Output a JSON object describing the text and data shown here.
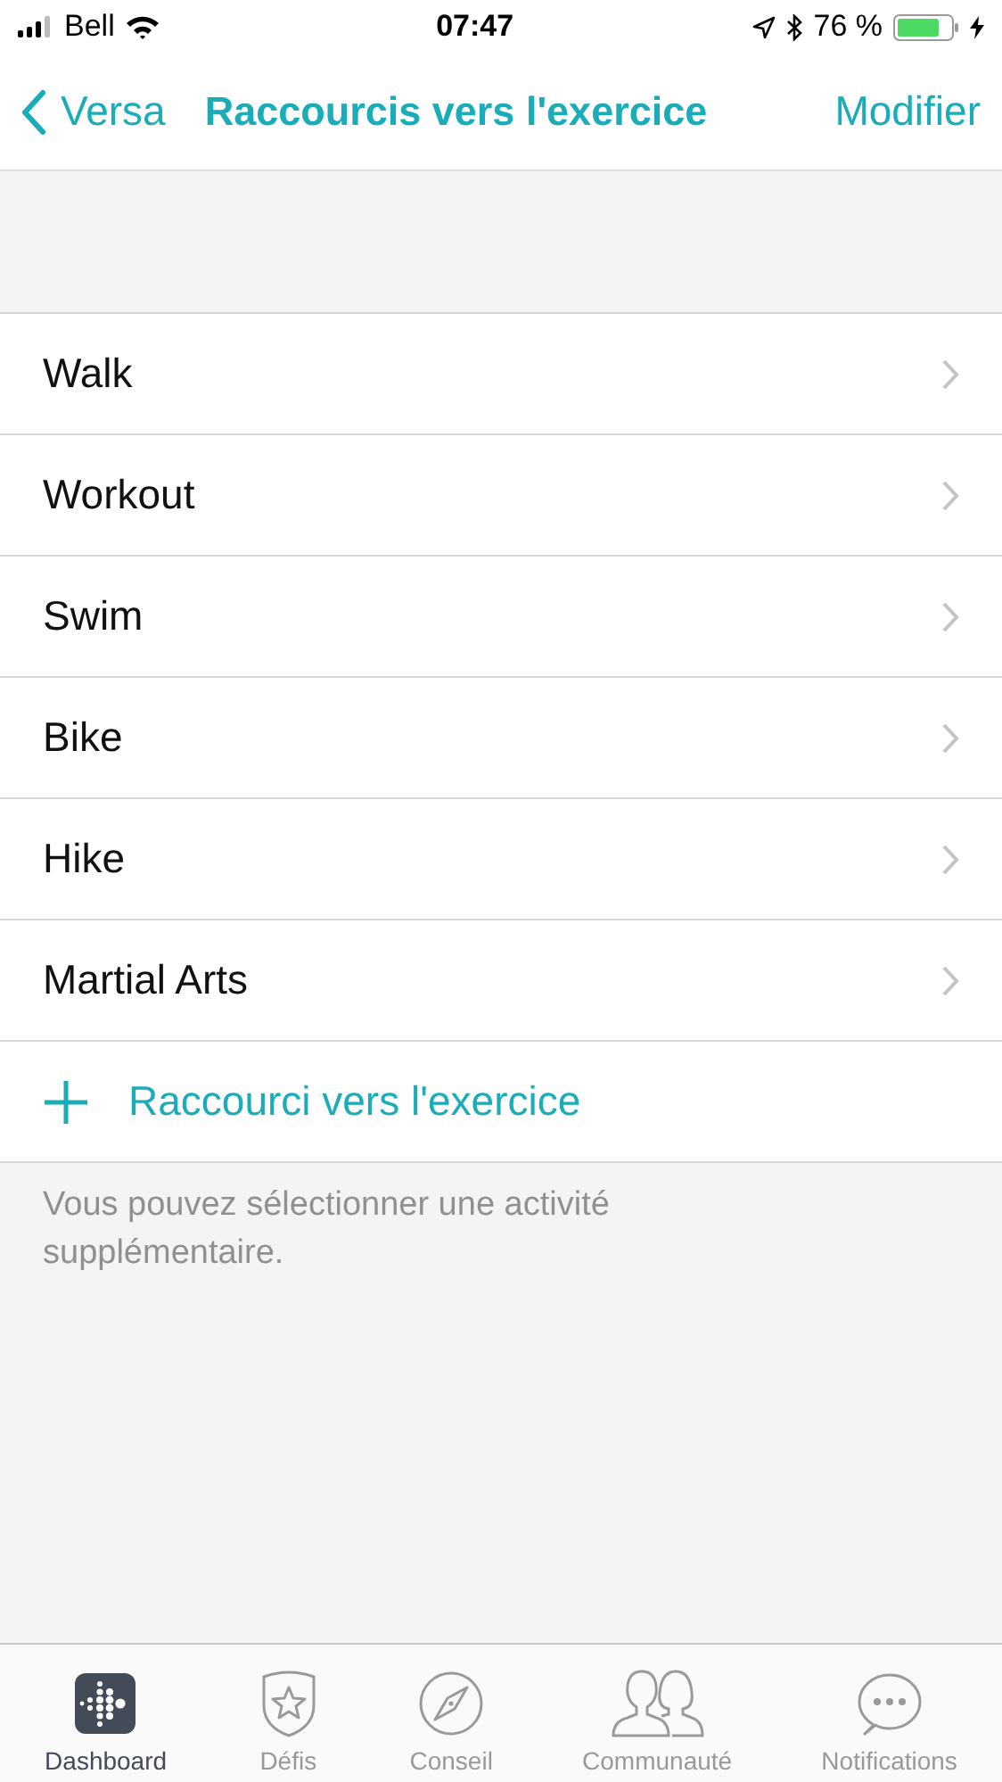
{
  "status_bar": {
    "carrier": "Bell",
    "time": "07:47",
    "battery": "76 %"
  },
  "nav": {
    "back": "Versa",
    "title": "Raccourcis vers l'exercice",
    "action": "Modifier"
  },
  "items": [
    {
      "label": "Walk"
    },
    {
      "label": "Workout"
    },
    {
      "label": "Swim"
    },
    {
      "label": "Bike"
    },
    {
      "label": "Hike"
    },
    {
      "label": "Martial Arts"
    }
  ],
  "add": {
    "label": "Raccourci vers l'exercice"
  },
  "note": "Vous pouvez sélectionner une activité supplémentaire.",
  "tabs": [
    {
      "label": "Dashboard",
      "selected": true
    },
    {
      "label": "Défis",
      "selected": false
    },
    {
      "label": "Conseil",
      "selected": false
    },
    {
      "label": "Communauté",
      "selected": false
    },
    {
      "label": "Notifications",
      "selected": false
    }
  ]
}
